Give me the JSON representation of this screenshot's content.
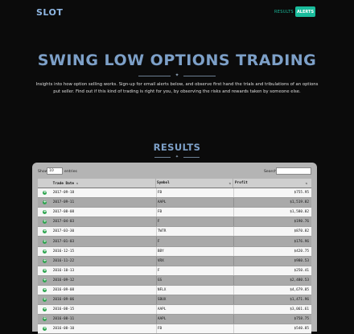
{
  "nav": {
    "brand": "SLOT",
    "results_link": "RESULTS",
    "alerts_button": "ALERTS"
  },
  "hero": {
    "title": "SWING LOW OPTIONS TRADING",
    "divider_icon": "star-icon",
    "description": "Insights into how option selling works. Sign-up for email alerts below, and observe first hand the trials and tribulations of an options put seller. Find out if this kind of trading is right for you, by observing the risks and rewards taken by someone else."
  },
  "results": {
    "title": "RESULTS",
    "divider_icon": "star-icon",
    "show_label": "Show",
    "page_size": "10",
    "entries_label": "entries",
    "search_label": "Search:",
    "search_value": "",
    "columns": [
      "Trade Date",
      "Symbol",
      "Profit"
    ],
    "rows": [
      {
        "date": "2017-09-18",
        "symbol": "FB",
        "profit": "$755.95"
      },
      {
        "date": "2017-09-11",
        "symbol": "AAPL",
        "profit": "$1,519.82"
      },
      {
        "date": "2017-08-08",
        "symbol": "FB",
        "profit": "$1,580.82"
      },
      {
        "date": "2017-04-03",
        "symbol": "F",
        "profit": "$190.76"
      },
      {
        "date": "2017-03-30",
        "symbol": "TWTR",
        "profit": "$870.82"
      },
      {
        "date": "2017-01-03",
        "symbol": "F",
        "profit": "$176.96"
      },
      {
        "date": "2016-12-15",
        "symbol": "BBY",
        "profit": "$420.75"
      },
      {
        "date": "2016-11-22",
        "symbol": "VRX",
        "profit": "$980.53"
      },
      {
        "date": "2016-10-13",
        "symbol": "F",
        "profit": "$250.41"
      },
      {
        "date": "2016-09-12",
        "symbol": "GS",
        "profit": "$2,480.53"
      },
      {
        "date": "2016-09-08",
        "symbol": "NFLX",
        "profit": "$4,679.85"
      },
      {
        "date": "2016-09-06",
        "symbol": "SBUX",
        "profit": "$1,471.96"
      },
      {
        "date": "2016-08-15",
        "symbol": "AAPL",
        "profit": "$3,061.61"
      },
      {
        "date": "2016-08-11",
        "symbol": "AAPL",
        "profit": "$758.75"
      },
      {
        "date": "2016-08-10",
        "symbol": "FB",
        "profit": "$540.85"
      }
    ]
  }
}
